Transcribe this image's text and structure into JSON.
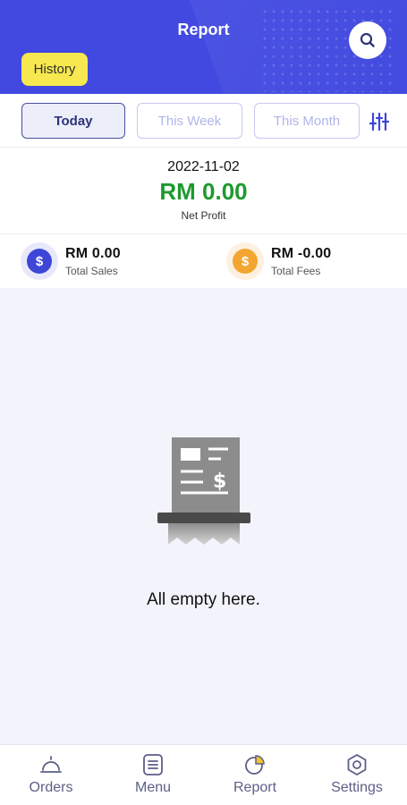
{
  "header": {
    "title": "Report",
    "history_label": "History",
    "search_icon": "search-icon",
    "accent_color": "#4149e0"
  },
  "filters": {
    "tabs": [
      {
        "label": "Today",
        "active": true
      },
      {
        "label": "This Week",
        "active": false
      },
      {
        "label": "This Month",
        "active": false
      }
    ],
    "settings_icon": "sliders-icon"
  },
  "summary": {
    "date": "2022-11-02",
    "net_profit": "RM 0.00",
    "net_profit_label": "Net Profit",
    "profit_color": "#1d9a2e"
  },
  "stats": {
    "sales": {
      "value": "RM 0.00",
      "label": "Total Sales",
      "icon": "dollar-coin-icon",
      "color": "#3d46d6"
    },
    "fees": {
      "value": "RM -0.00",
      "label": "Total Fees",
      "icon": "dollar-coin-icon",
      "color": "#f2a530"
    }
  },
  "empty_state": {
    "message": "All empty here.",
    "icon": "receipt-icon"
  },
  "bottom_nav": {
    "items": [
      {
        "label": "Orders",
        "icon": "service-bell-icon"
      },
      {
        "label": "Menu",
        "icon": "menu-list-icon"
      },
      {
        "label": "Report",
        "icon": "pie-chart-icon"
      },
      {
        "label": "Settings",
        "icon": "gear-icon"
      }
    ]
  }
}
